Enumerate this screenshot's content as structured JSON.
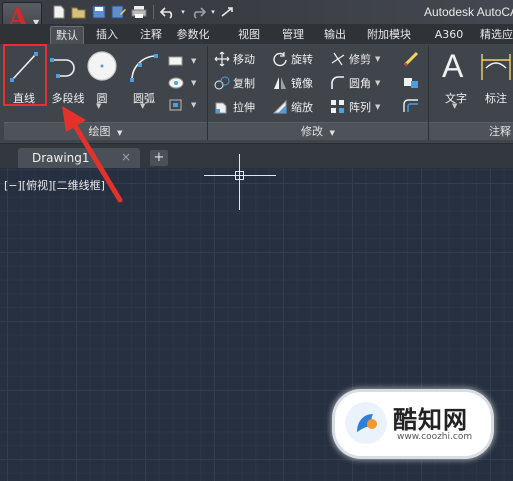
{
  "titlebar": {
    "app_letter": "A",
    "title": "Autodesk AutoCAD",
    "quick_access": [
      "new-file-icon",
      "open-file-icon",
      "save-icon",
      "save-as-icon",
      "print-icon",
      "undo-icon",
      "redo-icon"
    ]
  },
  "ribbon_tabs": [
    "默认",
    "插入",
    "注释",
    "参数化",
    "视图",
    "管理",
    "输出",
    "附加模块",
    "A360",
    "精选应用"
  ],
  "active_tab": "默认",
  "draw_panel": {
    "title": "绘图",
    "line": "直线",
    "polyline": "多段线",
    "circle": "圆",
    "arc": "圆弧"
  },
  "modify_panel": {
    "title": "修改",
    "move": "移动",
    "rotate": "旋转",
    "trim": "修剪",
    "copy": "复制",
    "mirror": "镜像",
    "fillet": "圆角",
    "stretch": "拉伸",
    "scale": "缩放",
    "array": "阵列"
  },
  "annotation_panel": {
    "title": "注释",
    "text": "文字",
    "dimension": "标注"
  },
  "document": {
    "tab_name": "Drawing1",
    "close_glyph": "×",
    "new_tab_glyph": "+"
  },
  "viewport": {
    "label": "[−][俯视][二维线框]"
  },
  "watermark": {
    "brand": "酷知网",
    "url": "www.coozhi.com"
  },
  "colors": {
    "canvas": "#263040",
    "highlight": "#e5312b",
    "app_letter": "#d22a2a"
  }
}
